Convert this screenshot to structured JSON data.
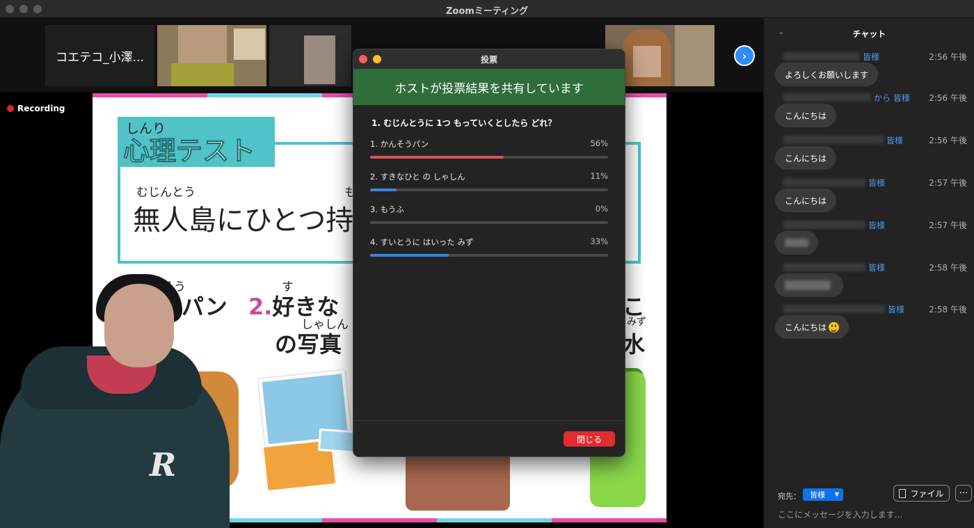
{
  "window": {
    "title": "Zoomミーティング"
  },
  "gallery": {
    "name_tile": "コエテコ_小澤...",
    "next_icon": "chevron-right-icon"
  },
  "recording": {
    "label": "Recording"
  },
  "slide": {
    "ruby_heading": "しんり",
    "heading": "心理テスト",
    "ruby_question": "むじんとう",
    "ruby_question_2": "も",
    "question": "無人島にひとつ持",
    "ruby_opt1": "そう",
    "opt1": "燥パン",
    "opt2_num": "2.",
    "ruby_opt2": "す",
    "opt2": "好きな",
    "ruby_opt2b": "しゃしん",
    "opt2b": "の写真",
    "opt4_top": "こ",
    "ruby_opt4": "みず",
    "opt4": "水"
  },
  "poll": {
    "window_title": "投票",
    "banner": "ホストが投票結果を共有しています",
    "question": "1. むじんとうに 1つ もっていくとしたら どれ？",
    "options": [
      {
        "label": "1. かんそうパン",
        "percent_text": "56%",
        "percent": 56,
        "color": "#e05252"
      },
      {
        "label": "2. すきなひと の しゃしん",
        "percent_text": "11%",
        "percent": 11,
        "color": "#3b86e0"
      },
      {
        "label": "3. もうふ",
        "percent_text": "0%",
        "percent": 0,
        "color": "#3b86e0"
      },
      {
        "label": "4. すいとうに はいった みず",
        "percent_text": "33%",
        "percent": 33,
        "color": "#3b86e0"
      }
    ],
    "close_label": "閉じる"
  },
  "chat": {
    "title": "チャット",
    "messages": [
      {
        "to": "皆様",
        "time": "2:56 午後",
        "text": "よろしくお願いします"
      },
      {
        "to": "から 皆様",
        "time": "2:56 午後",
        "text": "こんにちは"
      },
      {
        "to": "皆様",
        "time": "2:56 午後",
        "text": "こんにちは"
      },
      {
        "to": "皆様",
        "time": "2:57 午後",
        "text": "こんにちは"
      },
      {
        "to": "皆様",
        "time": "2:57 午後",
        "text": ""
      },
      {
        "to": "皆様",
        "time": "2:58 午後",
        "text": ""
      },
      {
        "to": "皆様",
        "time": "2:58 午後",
        "text": "こんにちは"
      }
    ],
    "to_label": "宛先：",
    "to_value": "皆様",
    "file_label": "ファイル",
    "more_label": "···",
    "input_placeholder": "ここにメッセージを入力します..."
  }
}
